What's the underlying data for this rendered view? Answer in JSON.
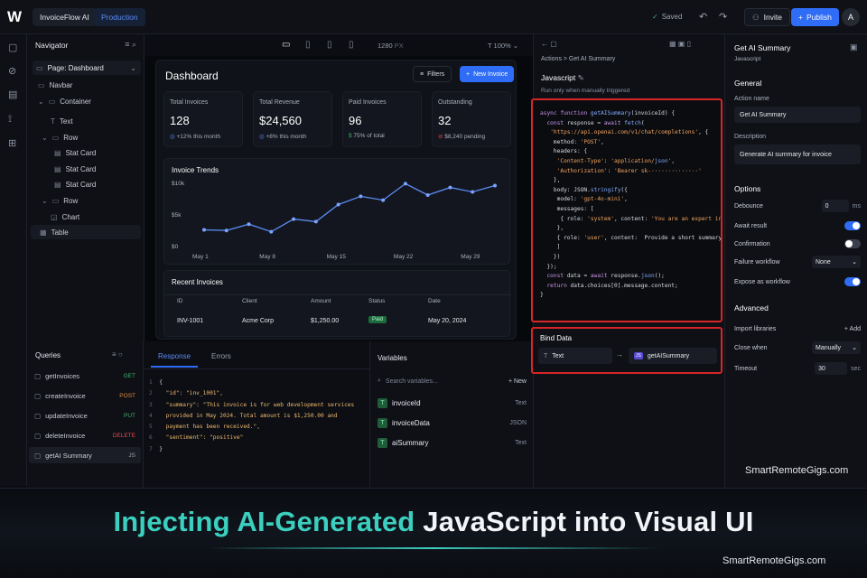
{
  "topbar": {
    "logo": "W",
    "project": "InvoiceFlow AI",
    "env": "Production",
    "saved": "Saved",
    "invite": "Invite",
    "publish": "Publish",
    "avatar": "A"
  },
  "navigator": {
    "title": "Navigator",
    "page": "Page: Dashboard",
    "items": [
      {
        "label": "Navbar"
      },
      {
        "label": "Container"
      },
      {
        "label": "Text"
      },
      {
        "label": "Row"
      },
      {
        "label": "Stat Card"
      },
      {
        "label": "Stat Card"
      },
      {
        "label": "Stat Card"
      },
      {
        "label": "Row"
      },
      {
        "label": "Chart"
      },
      {
        "label": "Table"
      }
    ]
  },
  "canvasbar": {
    "width": "1280",
    "unit": "PX",
    "zoom": "100%"
  },
  "dashboard": {
    "title": "Dashboard",
    "filters": "Filters",
    "new_invoice": "New Invoice",
    "cards": [
      {
        "label": "Total Invoices",
        "value": "128",
        "sub": "+12% this month"
      },
      {
        "label": "Total Revenue",
        "value": "$24,560",
        "sub": "+8% this month"
      },
      {
        "label": "Paid Invoices",
        "value": "96",
        "sub": "75% of total"
      },
      {
        "label": "Outstanding",
        "value": "32",
        "sub": "$8,240 pending"
      }
    ],
    "trend_title": "Invoice Trends",
    "recent_title": "Recent Invoices",
    "table_headers": [
      "ID",
      "Client",
      "Amount",
      "Status",
      "Date"
    ],
    "table_rows": [
      {
        "id": "INV-1001",
        "client": "Acme Corp",
        "amount": "$1,250.00",
        "status": "Paid",
        "date": "May 20, 2024"
      }
    ]
  },
  "chart_data": {
    "type": "line",
    "categories": [
      "May 1",
      "",
      "May 8",
      "",
      "",
      "May 15",
      "",
      "",
      "May 22",
      "",
      "",
      "May 29",
      ""
    ],
    "yticks": [
      "$10k",
      "$5k",
      "$0"
    ],
    "ylim": [
      0,
      10000
    ],
    "values": [
      2500,
      2400,
      3400,
      2200,
      4200,
      3800,
      6500,
      7800,
      7200,
      9800,
      8000,
      9200,
      8500,
      9500
    ]
  },
  "queries": {
    "title": "Queries",
    "items": [
      {
        "name": "getInvoices",
        "method": "GET"
      },
      {
        "name": "createInvoice",
        "method": "POST"
      },
      {
        "name": "updateInvoice",
        "method": "PUT"
      },
      {
        "name": "deleteInvoice",
        "method": "DELETE"
      },
      {
        "name": "getAI Summary",
        "method": "JS"
      }
    ]
  },
  "response": {
    "tab1": "Response",
    "tab2": "Errors",
    "lines": [
      "{",
      "  \"id\": \"inv_1001\",",
      "  \"summary\": \"This invoice is for web development services",
      "  provided in May 2024. Total amount is $1,250.00 and",
      "  payment has been received.\",",
      "  \"sentiment\": \"positive\"",
      "}"
    ]
  },
  "variables": {
    "title": "Variables",
    "search": "Search variables...",
    "new": "New",
    "items": [
      {
        "name": "invoiceId",
        "type": "Text"
      },
      {
        "name": "invoiceData",
        "type": "JSON"
      },
      {
        "name": "aiSummary",
        "type": "Text"
      }
    ]
  },
  "js": {
    "breadcrumb": "Actions > Get AI Summary",
    "title": "Javascript",
    "note": "Run only when manually triggered",
    "bind_title": "Bind Data",
    "bind_from": "Text",
    "bind_to": "getAISummary"
  },
  "code_lines": [
    "async function getAISummary(invoiceId) {",
    "  const response = await fetch(",
    "   'https://api.openai.com/v1/chat/completions', {",
    "    method: 'POST',",
    "    headers: {",
    "     'Content-Type': 'application/json',",
    "     'Authorization': 'Bearer sk-··············'",
    "    },",
    "    body: JSON.stringify({",
    "     model: 'gpt-4o-mini',",
    "     messages: [",
    "      { role: 'system', content: 'You are an expert invoi",
    "     },",
    "     { role: 'user', content:  Provide a short summary fo",
    "     ]",
    "    })",
    "  });",
    "  const data = await response.json();",
    "  return data.choices[0].message.content;",
    "}"
  ],
  "props": {
    "title": "Get AI Summary",
    "subtitle": "Javascript",
    "general": "General",
    "action_name_label": "Action name",
    "action_name": "Get AI Summary",
    "desc_label": "Description",
    "desc": "Generate AI summary for invoice",
    "options": "Options",
    "debounce": "Debounce",
    "debounce_val": "0",
    "debounce_unit": "ms",
    "await": "Await result",
    "confirm": "Confirmation",
    "failure": "Failure workflow",
    "failure_val": "None",
    "expose": "Expose as workflow",
    "advanced": "Advanced",
    "import": "Import libraries",
    "add": "Add",
    "close": "Close when",
    "close_val": "Manually",
    "timeout": "Timeout",
    "timeout_val": "30",
    "timeout_unit": "sec"
  },
  "banner": {
    "part1": "Injecting AI-Generated",
    "part2": "JavaScript into Visual UI",
    "watermark": "SmartRemoteGigs.com"
  }
}
